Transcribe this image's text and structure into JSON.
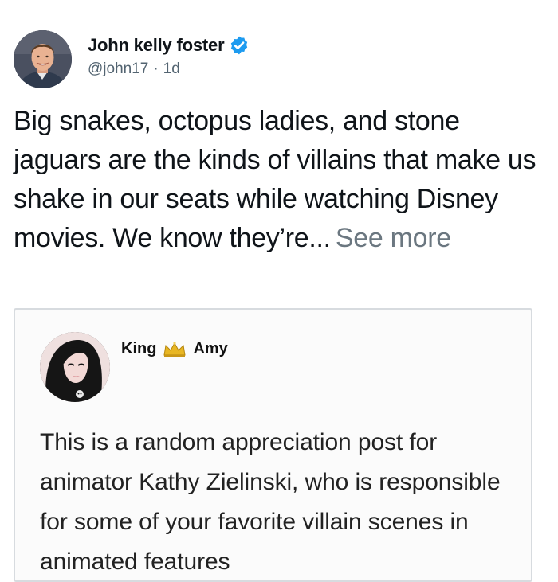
{
  "tweet": {
    "author_name": "John kelly foster",
    "author_handle": "@john17",
    "separator": "·",
    "age": "1d",
    "verified": true,
    "text": "Big snakes, octopus ladies, and stone jaguars are the kinds of villains that make us shake in our seats while watching Disney movies. We know they’re...",
    "see_more_label": "See more"
  },
  "quote": {
    "name_first": "King",
    "name_second": "Amy",
    "crown_icon": "crown-icon",
    "text": "This is a random appreciation post for animator Kathy Zielinski, who is responsible for some of your favorite villain scenes in animated features"
  },
  "colors": {
    "verified": "#1d9bf0",
    "secondary_text": "#536471",
    "card_border": "#d7dbdf"
  }
}
